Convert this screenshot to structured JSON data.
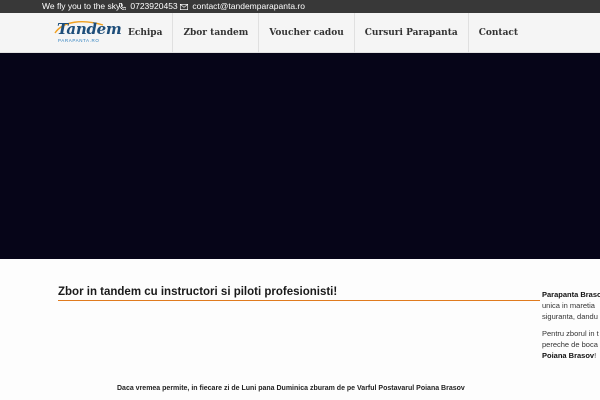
{
  "topbar": {
    "tagline": "We fly you to the sky!",
    "phone": "0723920453",
    "email": "contact@tandemparapanta.ro",
    "phone_icon": "phone-icon",
    "email_icon": "envelope-icon"
  },
  "logo": {
    "text": "Tandem",
    "subtext": "PARAPANTA.RO"
  },
  "nav": {
    "items": [
      "Echipa",
      "Zbor tandem",
      "Voucher cadou",
      "Cursuri Parapanta",
      "Contact"
    ]
  },
  "content": {
    "headline": "Zbor in tandem cu instructori si piloti profesionisti!",
    "info": "Daca vremea permite, in fiecare zi de Luni pana Duminica zburam de pe Varful Postavarul Poiana Brasov"
  },
  "sidebar": {
    "brand": "Parapanta Brasov",
    "line1": "unica in maretia",
    "line2": "siguranta, dandu",
    "line3": "Pentru zborul in t",
    "line4": "pereche de boca",
    "place": "Poiana Brasov",
    "place_suffix": "!"
  },
  "colors": {
    "topbar_bg": "#383838",
    "hero_bg": "#060518",
    "accent_line": "#e07b1e",
    "logo_blue": "#1e4e7a"
  }
}
